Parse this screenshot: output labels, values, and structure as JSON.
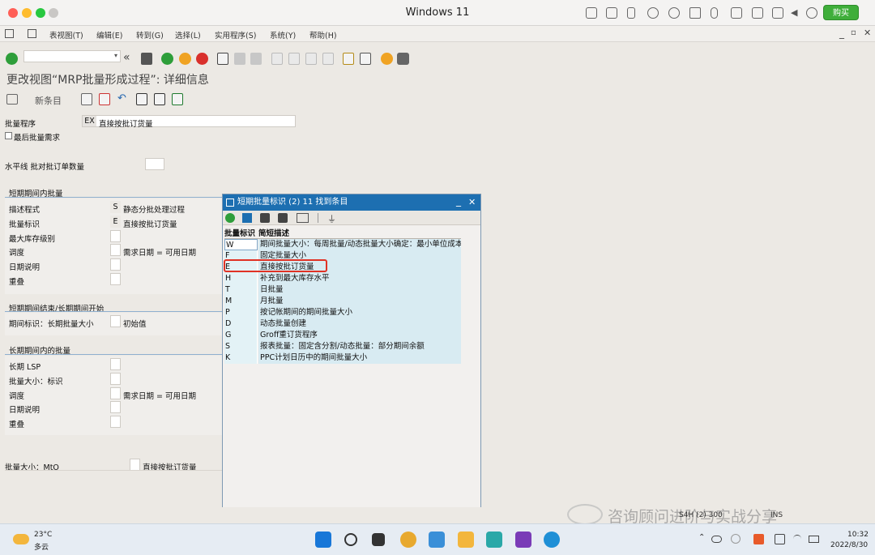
{
  "window": {
    "title": "Windows 11",
    "buy_label": "购买"
  },
  "menu": [
    "表视图(T)",
    "编辑(E)",
    "转到(G)",
    "选择(L)",
    "实用程序(S)",
    "系统(Y)",
    "帮助(H)"
  ],
  "screen_title": "更改视图“MRP批量形成过程”: 详细信息",
  "app_toolbar": {
    "new_entries": "新条目"
  },
  "form": {
    "lot_proc_label": "批量程序",
    "lot_proc_code": "EX",
    "lot_proc_value": "直接按批订货量",
    "last_lot_label": "最后批量需求",
    "horizon_label": "水平线 批对批订单数量",
    "short_section": "短期期间内批量",
    "short_rows": [
      {
        "label": "描述程式",
        "code": "S",
        "value": "静态分批处理过程"
      },
      {
        "label": "批量标识",
        "code": "E",
        "value": "直接按批订货量"
      },
      {
        "label": "最大库存级别",
        "code": "",
        "value": ""
      },
      {
        "label": "调度",
        "code": "",
        "value": "需求日期 = 可用日期"
      },
      {
        "label": "日期说明",
        "code": "",
        "value": ""
      },
      {
        "label": "重叠",
        "code": "",
        "value": ""
      }
    ],
    "end_section": "短期期间结束/长期期间开始",
    "period_label": "期间标识：长期批量大小",
    "period_value": "初始值",
    "long_section": "长期期间内的批量",
    "long_rows": [
      {
        "label": "长期 LSP",
        "value": ""
      },
      {
        "label": "批量大小：标识",
        "value": ""
      },
      {
        "label": "调度",
        "value": "需求日期 = 可用日期"
      },
      {
        "label": "日期说明",
        "value": ""
      },
      {
        "label": "重叠",
        "value": ""
      }
    ],
    "mto_label": "批量大小：MtO",
    "mto_value": "直接按批订货量"
  },
  "popup": {
    "title": "短期批量标识 (2)   11 找到条目",
    "col_key": "批量标识",
    "col_desc": "简短描述",
    "rows": [
      {
        "key": "W",
        "desc": "期间批量大小：每周批量/动态批量大小确定：最小单位成本"
      },
      {
        "key": "F",
        "desc": "固定批量大小"
      },
      {
        "key": "E",
        "desc": "直接按批订货量"
      },
      {
        "key": "H",
        "desc": "补充到最大库存水平"
      },
      {
        "key": "T",
        "desc": "日批量"
      },
      {
        "key": "M",
        "desc": "月批量"
      },
      {
        "key": "P",
        "desc": "按记帐期间的期间批量大小"
      },
      {
        "key": "D",
        "desc": "动态批量创建"
      },
      {
        "key": "G",
        "desc": "Groff重订货程序"
      },
      {
        "key": "S",
        "desc": "报表批量：固定含分割/动态批量：部分期间余额"
      },
      {
        "key": "K",
        "desc": "PPC计划日历中的期间批量大小"
      }
    ]
  },
  "status": {
    "server": "S4H (2) 300",
    "mode": "INS",
    "watermark": "咨询顾问进阶与实战分享"
  },
  "taskbar": {
    "temp": "23°C",
    "weather": "多云",
    "time": "10:32",
    "date": "2022/8/30"
  }
}
